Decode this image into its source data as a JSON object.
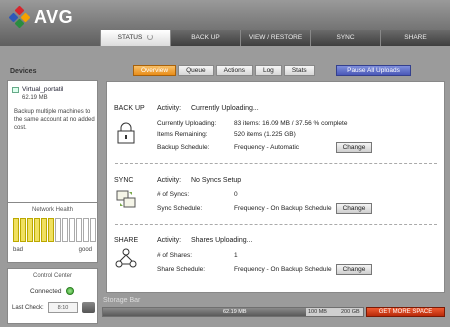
{
  "app": {
    "logo_text": "AVG",
    "brand_colors": [
      "#d6252d",
      "#f6a100",
      "#2a8c3f",
      "#2f58b8"
    ]
  },
  "tabs": [
    {
      "label": "STATUS",
      "active": true
    },
    {
      "label": "BACK UP",
      "active": false
    },
    {
      "label": "VIEW / RESTORE",
      "active": false
    },
    {
      "label": "SYNC",
      "active": false
    },
    {
      "label": "SHARE",
      "active": false
    }
  ],
  "sidebar": {
    "devices_title": "Devices",
    "device": {
      "name": "Virtual_portatil",
      "size": "62.19 MB",
      "icon": "computer-icon"
    },
    "device_note": "Backup multiple machines to the same account at no added cost.",
    "network_health": {
      "title": "Network Health",
      "bad_label": "bad",
      "good_label": "good",
      "level": 0.5
    },
    "control_center": {
      "title": "Control Center",
      "status": "Connected",
      "last_check_label": "Last Check:",
      "last_check_value": "8:10"
    }
  },
  "subtabs": [
    {
      "label": "Overview",
      "active": true
    },
    {
      "label": "Queue",
      "active": false
    },
    {
      "label": "Actions",
      "active": false
    },
    {
      "label": "Log",
      "active": false
    },
    {
      "label": "Stats",
      "active": false
    }
  ],
  "pause_button": "Pause All Uploads",
  "backup": {
    "label": "BACK UP",
    "activity_label": "Activity:",
    "activity_value": "Currently Uploading...",
    "rows": [
      {
        "label": "Currently Uploading:",
        "value": "83 items: 16.09 MB / 37.56 % complete"
      },
      {
        "label": "Items Remaining:",
        "value": "520 items (1.225 GB)"
      },
      {
        "label": "Backup Schedule:",
        "value": "Frequency - Automatic"
      }
    ],
    "change_label": "Change"
  },
  "sync": {
    "label": "SYNC",
    "activity_label": "Activity:",
    "activity_value": "No Syncs Setup",
    "rows": [
      {
        "label": "# of Syncs:",
        "value": "0"
      },
      {
        "label": "Sync Schedule:",
        "value": "Frequency - On Backup Schedule"
      }
    ],
    "change_label": "Change"
  },
  "share": {
    "label": "SHARE",
    "activity_label": "Activity:",
    "activity_value": "Shares Uploading...",
    "rows": [
      {
        "label": "# of Shares:",
        "value": "1"
      },
      {
        "label": "Share Schedule:",
        "value": "Frequency - On Backup Schedule"
      }
    ],
    "change_label": "Change"
  },
  "storage": {
    "label": "Storage Bar",
    "used": "62.19 MB",
    "mark_100": "100 MB",
    "mark_200": "200 GB",
    "fill_fraction": 0.78,
    "more_button": "GET MORE SPACE"
  }
}
